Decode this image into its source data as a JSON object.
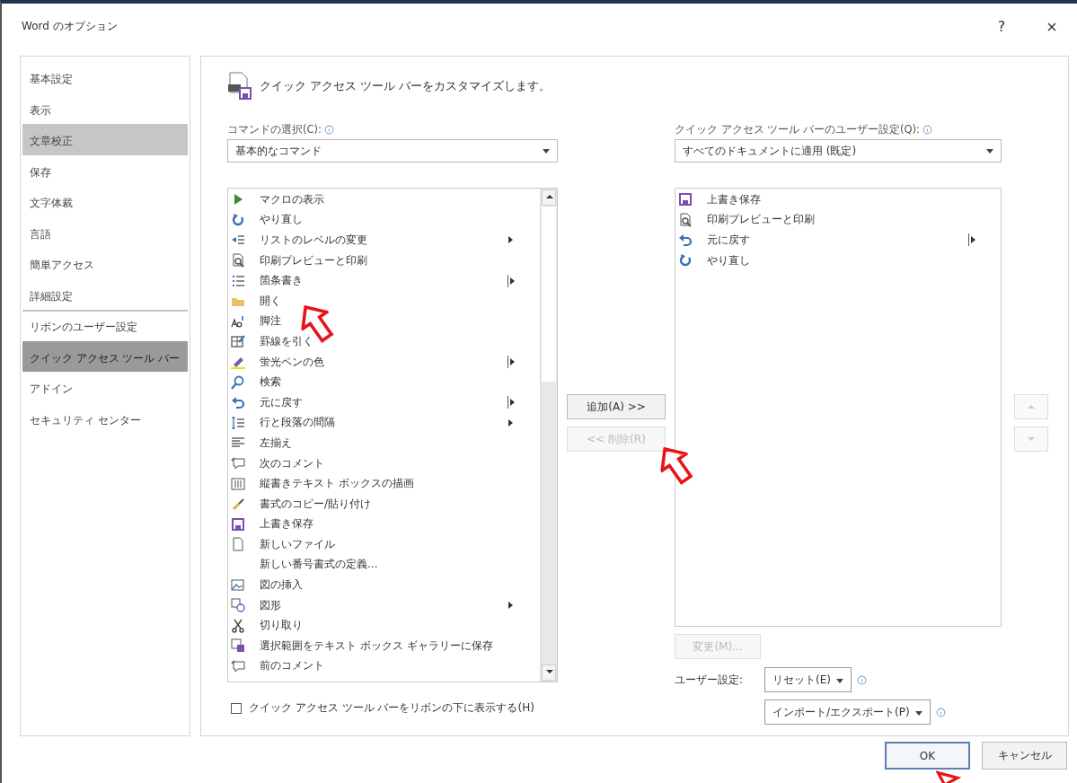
{
  "window": {
    "title": "Word のオプション",
    "help": "?",
    "close": "×"
  },
  "sidebar": {
    "items": [
      {
        "label": "基本設定",
        "selected": false,
        "hovered": false,
        "separator_above": false
      },
      {
        "label": "表示",
        "selected": false,
        "hovered": false,
        "separator_above": false
      },
      {
        "label": "文章校正",
        "selected": false,
        "hovered": true,
        "separator_above": false
      },
      {
        "label": "保存",
        "selected": false,
        "hovered": false,
        "separator_above": false
      },
      {
        "label": "文字体裁",
        "selected": false,
        "hovered": false,
        "separator_above": false
      },
      {
        "label": "言語",
        "selected": false,
        "hovered": false,
        "separator_above": false
      },
      {
        "label": "簡単アクセス",
        "selected": false,
        "hovered": false,
        "separator_above": false
      },
      {
        "label": "詳細設定",
        "selected": false,
        "hovered": false,
        "separator_above": false
      },
      {
        "label": "リボンのユーザー設定",
        "selected": false,
        "hovered": false,
        "separator_above": true
      },
      {
        "label": "クイック アクセス ツール バー",
        "selected": true,
        "hovered": false,
        "separator_above": false
      },
      {
        "label": "アドイン",
        "selected": false,
        "hovered": false,
        "separator_above": false
      },
      {
        "label": "セキュリティ センター",
        "selected": false,
        "hovered": false,
        "separator_above": false
      }
    ]
  },
  "header": "クイック アクセス ツール バーをカスタマイズします。",
  "commands": {
    "label": "コマンドの選択(C):",
    "select": {
      "value": "基本的なコマンド"
    },
    "items": [
      {
        "label": "マクロの表示",
        "kind": "plain"
      },
      {
        "label": "やり直し",
        "kind": "plain"
      },
      {
        "label": "リストのレベルの変更",
        "kind": "submenu"
      },
      {
        "label": "印刷プレビューと印刷",
        "kind": "plain"
      },
      {
        "label": "箇条書き",
        "kind": "split"
      },
      {
        "label": "開く",
        "kind": "plain"
      },
      {
        "label": "脚注",
        "kind": "plain"
      },
      {
        "label": "罫線を引く",
        "kind": "plain"
      },
      {
        "label": "蛍光ペンの色",
        "kind": "split"
      },
      {
        "label": "検索",
        "kind": "plain"
      },
      {
        "label": "元に戻す",
        "kind": "split"
      },
      {
        "label": "行と段落の間隔",
        "kind": "submenu"
      },
      {
        "label": "左揃え",
        "kind": "plain"
      },
      {
        "label": "次のコメント",
        "kind": "plain"
      },
      {
        "label": "縦書きテキスト ボックスの描画",
        "kind": "plain"
      },
      {
        "label": "書式のコピー/貼り付け",
        "kind": "plain"
      },
      {
        "label": "上書き保存",
        "kind": "plain"
      },
      {
        "label": "新しいファイル",
        "kind": "plain"
      },
      {
        "label": "新しい番号書式の定義...",
        "kind": "plain"
      },
      {
        "label": "図の挿入",
        "kind": "plain"
      },
      {
        "label": "図形",
        "kind": "submenu"
      },
      {
        "label": "切り取り",
        "kind": "plain"
      },
      {
        "label": "選択範囲をテキスト ボックス ギャラリーに保存",
        "kind": "plain"
      },
      {
        "label": "前のコメント",
        "kind": "plain"
      }
    ],
    "show_below_ribbon": {
      "label": "クイック アクセス ツール バーをリボンの下に表示する(H)",
      "checked": false
    }
  },
  "add_button": {
    "label": "追加(A) >>",
    "disabled": false
  },
  "remove_button": {
    "label": "<< 削除(R)",
    "disabled": true
  },
  "qat": {
    "label": "クイック アクセス ツール バーのユーザー設定(Q):",
    "select": {
      "value": "すべてのドキュメントに適用 (既定)"
    },
    "items": [
      {
        "label": "上書き保存",
        "kind": "plain"
      },
      {
        "label": "印刷プレビューと印刷",
        "kind": "plain"
      },
      {
        "label": "元に戻す",
        "kind": "split"
      },
      {
        "label": "やり直し",
        "kind": "plain"
      }
    ],
    "modify_button": {
      "label": "変更(M)...",
      "disabled": true
    },
    "customizations_label": "ユーザー設定:",
    "reset_button": "リセット(E)",
    "import_export_button": "インポート/エクスポート(P)"
  },
  "ok_button": "OK",
  "cancel_button": "キャンセル"
}
